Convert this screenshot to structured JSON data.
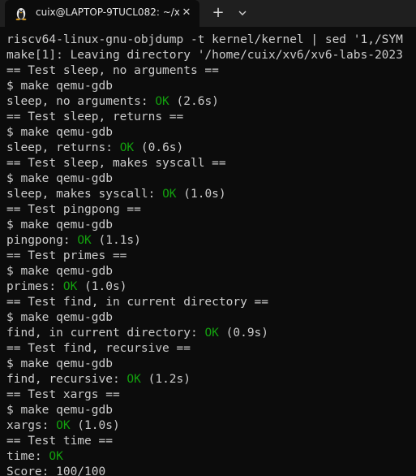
{
  "window": {
    "tab_title": "cuix@LAPTOP-9TUCL082: ~/x",
    "tab_icon": "linux-penguin-icon",
    "close_glyph": "✕",
    "new_tab_glyph": "+",
    "dropdown_icon": "chevron-down-icon"
  },
  "colors": {
    "background": "#0c0c0c",
    "titlebar": "#1f1f1f",
    "text": "#cccccc",
    "ok_green": "#13a10e"
  },
  "terminal": {
    "lines": [
      {
        "pre": "riscv64-linux-gnu-objdump -t kernel/kernel | sed '1,/SYM"
      },
      {
        "pre": "make[1]: Leaving directory '/home/cuix/xv6/xv6-labs-2023"
      },
      {
        "pre": "== Test sleep, no arguments =="
      },
      {
        "pre": "$ make qemu-gdb"
      },
      {
        "pre": "sleep, no arguments: ",
        "ok": "OK",
        "post": " (2.6s)"
      },
      {
        "pre": "== Test sleep, returns =="
      },
      {
        "pre": "$ make qemu-gdb"
      },
      {
        "pre": "sleep, returns: ",
        "ok": "OK",
        "post": " (0.6s)"
      },
      {
        "pre": "== Test sleep, makes syscall =="
      },
      {
        "pre": "$ make qemu-gdb"
      },
      {
        "pre": "sleep, makes syscall: ",
        "ok": "OK",
        "post": " (1.0s)"
      },
      {
        "pre": "== Test pingpong =="
      },
      {
        "pre": "$ make qemu-gdb"
      },
      {
        "pre": "pingpong: ",
        "ok": "OK",
        "post": " (1.1s)"
      },
      {
        "pre": "== Test primes =="
      },
      {
        "pre": "$ make qemu-gdb"
      },
      {
        "pre": "primes: ",
        "ok": "OK",
        "post": " (1.0s)"
      },
      {
        "pre": "== Test find, in current directory =="
      },
      {
        "pre": "$ make qemu-gdb"
      },
      {
        "pre": "find, in current directory: ",
        "ok": "OK",
        "post": " (0.9s)"
      },
      {
        "pre": "== Test find, recursive =="
      },
      {
        "pre": "$ make qemu-gdb"
      },
      {
        "pre": "find, recursive: ",
        "ok": "OK",
        "post": " (1.2s)"
      },
      {
        "pre": "== Test xargs =="
      },
      {
        "pre": "$ make qemu-gdb"
      },
      {
        "pre": "xargs: ",
        "ok": "OK",
        "post": " (1.0s)"
      },
      {
        "pre": "== Test time =="
      },
      {
        "pre": "time: ",
        "ok": "OK"
      },
      {
        "pre": "Score: 100/100"
      }
    ]
  }
}
